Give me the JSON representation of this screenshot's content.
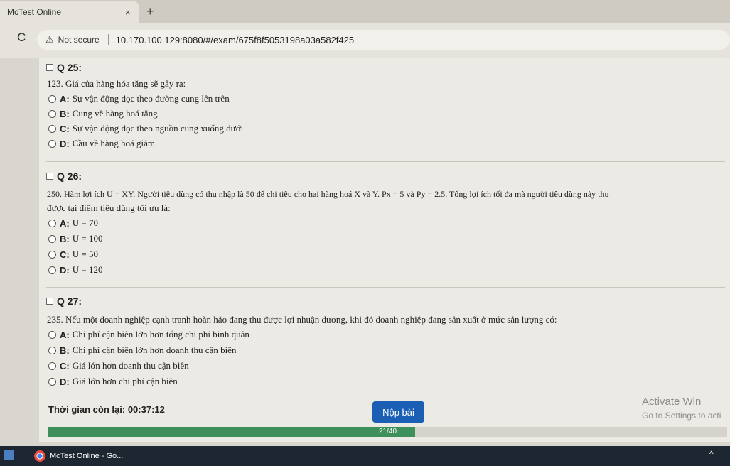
{
  "browser": {
    "tab_title": "McTest Online",
    "tab_close": "×",
    "new_tab": "+",
    "reload_icon": "C",
    "security_label": "Not secure",
    "url": "10.170.100.129:8080/#/exam/675f8f5053198a03a582f425"
  },
  "questions": [
    {
      "label": "Q 25:",
      "text": "123. Giá của hàng hóa tăng sẽ gây ra:",
      "options": [
        {
          "key": "A:",
          "text": "Sự vận động dọc theo đường cung lên trên"
        },
        {
          "key": "B:",
          "text": "Cung về hàng hoá tăng"
        },
        {
          "key": "C:",
          "text": "Sự vận động dọc theo nguồn cung xuống dưới"
        },
        {
          "key": "D:",
          "text": "Cầu về hàng hoá giảm"
        }
      ]
    },
    {
      "label": "Q 26:",
      "text": "250. Hàm lợi ích U = XY. Người tiêu dùng có thu nhập là 50 để chi tiêu cho hai hàng hoá X và Y. Px = 5 và Py = 2.5. Tổng lợi ích tối đa mà người tiêu dùng này thu",
      "text2": "được tại điểm tiêu dùng tối ưu là:",
      "options": [
        {
          "key": "A:",
          "text": "U = 70"
        },
        {
          "key": "B:",
          "text": "U = 100"
        },
        {
          "key": "C:",
          "text": "U = 50"
        },
        {
          "key": "D:",
          "text": "U = 120"
        }
      ]
    },
    {
      "label": "Q 27:",
      "text": "235. Nếu một doanh nghiệp cạnh tranh hoàn hảo đang thu được lợi nhuận dương, khi đó doanh nghiệp đang sản xuất ở mức sản lượng có:",
      "options": [
        {
          "key": "A:",
          "text": "Chi phí cận biên lớn hơn tổng chi phí bình quân"
        },
        {
          "key": "B:",
          "text": "Chi phí cận biên lớn hơn doanh thu cận biên"
        },
        {
          "key": "C:",
          "text": "Giá lớn hơn doanh thu cận biên"
        },
        {
          "key": "D:",
          "text": "Giá lớn hơn chi phí cận biên"
        }
      ]
    }
  ],
  "footer": {
    "timer_label": "Thời gian còn lại:",
    "timer_value": "00:37:12",
    "submit_label": "Nộp bài",
    "progress_text": "21/40",
    "progress_fraction": 0.54
  },
  "watermark": {
    "line1": "Activate Win",
    "line2": "Go to Settings to acti"
  },
  "taskbar": {
    "app_label": "McTest Online - Go..."
  }
}
